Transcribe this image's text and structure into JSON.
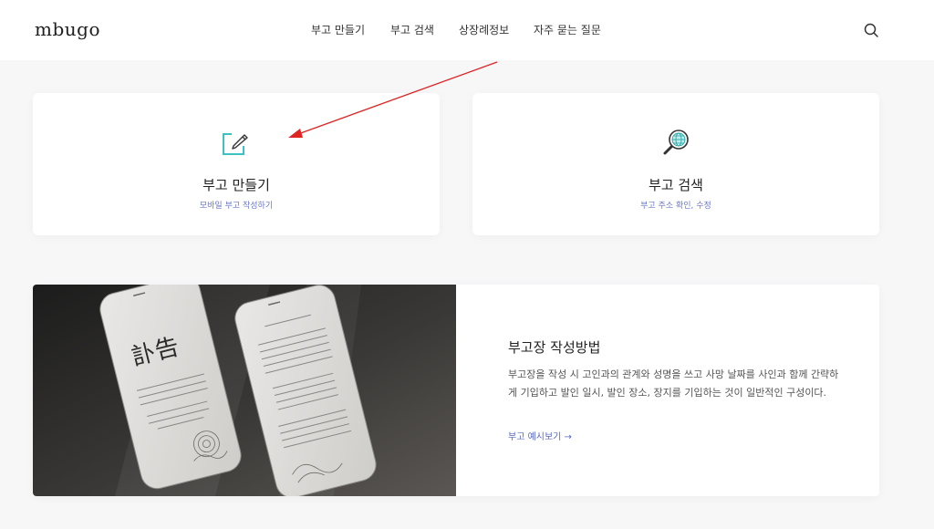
{
  "header": {
    "logo": "mbugo",
    "nav": [
      {
        "label": "부고 만들기"
      },
      {
        "label": "부고 검색"
      },
      {
        "label": "상장례정보"
      },
      {
        "label": "자주 묻는 질문"
      }
    ],
    "search_icon": "search-icon"
  },
  "cards": {
    "make": {
      "title": "부고 만들기",
      "subtitle": "모바일 부고 작성하기",
      "icon": "edit-square-icon"
    },
    "search": {
      "title": "부고 검색",
      "subtitle": "부고 주소 확인, 수정",
      "icon": "globe-magnifier-icon"
    }
  },
  "guide": {
    "title": "부고장 작성방법",
    "description": "부고장을 작성 시 고인과의 관계와 성명을 쓰고 사망 날짜를 사인과 함께 간략하게 기입하고 발인 일시, 발인 장소, 장지를 기입하는 것이 일반적인 구성이다.",
    "link_label": "부고 예시보기 →",
    "photo": {
      "phone_heading": "訃告",
      "icon": "phone-photo"
    }
  },
  "colors": {
    "accent": "#5868c0",
    "teal": "#3ec1c1",
    "annotation_arrow": "#e02424"
  }
}
